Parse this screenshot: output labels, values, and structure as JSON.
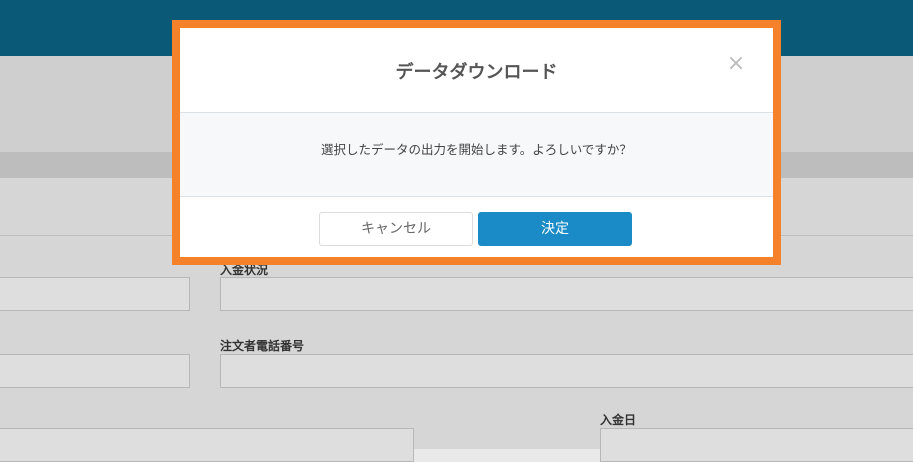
{
  "background": {
    "labels": {
      "payment_status": "入金状況",
      "orderer_phone": "注文者電話番号",
      "payment_date": "入金日"
    }
  },
  "modal": {
    "title": "データダウンロード",
    "close_glyph": "×",
    "message": "選択したデータの出力を開始します。よろしいですか？",
    "cancel_label": "キャンセル",
    "confirm_label": "決定"
  },
  "colors": {
    "topbar": "#0a5977",
    "highlight_border": "#f5822a",
    "primary_button": "#1a8bc6"
  }
}
